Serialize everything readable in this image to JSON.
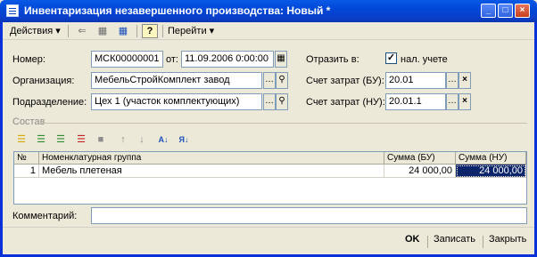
{
  "window": {
    "title": "Инвентаризация незавершенного производства: Новый *",
    "controls": {
      "minimize": "_",
      "maximize": "□",
      "close": "×"
    }
  },
  "menubar": {
    "actions": "Действия ▾",
    "goto": "Перейти ▾"
  },
  "toolbar_icons": [
    "back-icon",
    "copy-icon",
    "post-icon",
    "help-icon"
  ],
  "header": {
    "number_label": "Номер:",
    "number_value": "МСК00000001",
    "date_label": "от:",
    "date_value": "11.09.2006  0:00:00",
    "organization_label": "Организация:",
    "organization_value": "МебельСтройКомплект завод",
    "division_label": "Подразделение:",
    "division_value": "Цех 1 (участок комплектующих)",
    "reflect_label": "Отразить в:",
    "tax_accounting_label": "нал. учете",
    "tax_accounting_checked": true,
    "cost_account_bu_label": "Счет затрат (БУ):",
    "cost_account_bu_value": "20.01",
    "cost_account_nu_label": "Счет затрат (НУ):",
    "cost_account_nu_value": "20.01.1"
  },
  "section": {
    "title": "Состав"
  },
  "table": {
    "columns": [
      "№",
      "Номенклатурная группа",
      "Сумма (БУ)",
      "Сумма (НУ)"
    ],
    "rows": [
      {
        "n": "1",
        "group": "Мебель плетеная",
        "sum_bu": "24 000,00",
        "sum_nu": "24 000,00"
      }
    ]
  },
  "comment": {
    "label": "Комментарий:",
    "value": ""
  },
  "footer": {
    "ok": "OK",
    "save": "Записать",
    "close": "Закрыть"
  },
  "colors": {
    "titlebar": "#0a5ae6",
    "selected_cell": "#0b246a",
    "panel": "#ece9d8"
  }
}
